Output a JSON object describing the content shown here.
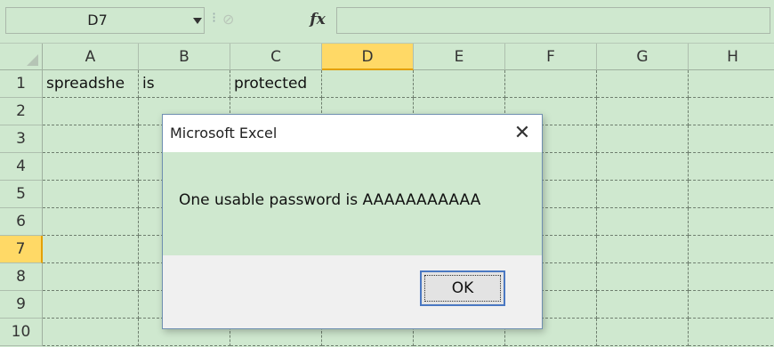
{
  "formula_bar": {
    "name_box": "D7",
    "separator": "⁝",
    "cancel_glyph": "⊘",
    "fx_label": "fx",
    "formula": ""
  },
  "grid": {
    "columns": [
      "A",
      "B",
      "C",
      "D",
      "E",
      "F",
      "G",
      "H"
    ],
    "rows": [
      "1",
      "2",
      "3",
      "4",
      "5",
      "6",
      "7",
      "8",
      "9",
      "10"
    ],
    "active_cell": "D7",
    "cells": {
      "A1": "spreadshe",
      "B1": "is",
      "C1": "protected"
    }
  },
  "dialog": {
    "title": "Microsoft Excel",
    "close_glyph": "✕",
    "message": "One usable password is AAAAAAAAAAA",
    "ok_label": "OK"
  },
  "colors": {
    "background": "#cfe8cf",
    "active_header": "#ffd966",
    "dialog_footer": "#f0f0f0",
    "button_border": "#4a78c2"
  }
}
